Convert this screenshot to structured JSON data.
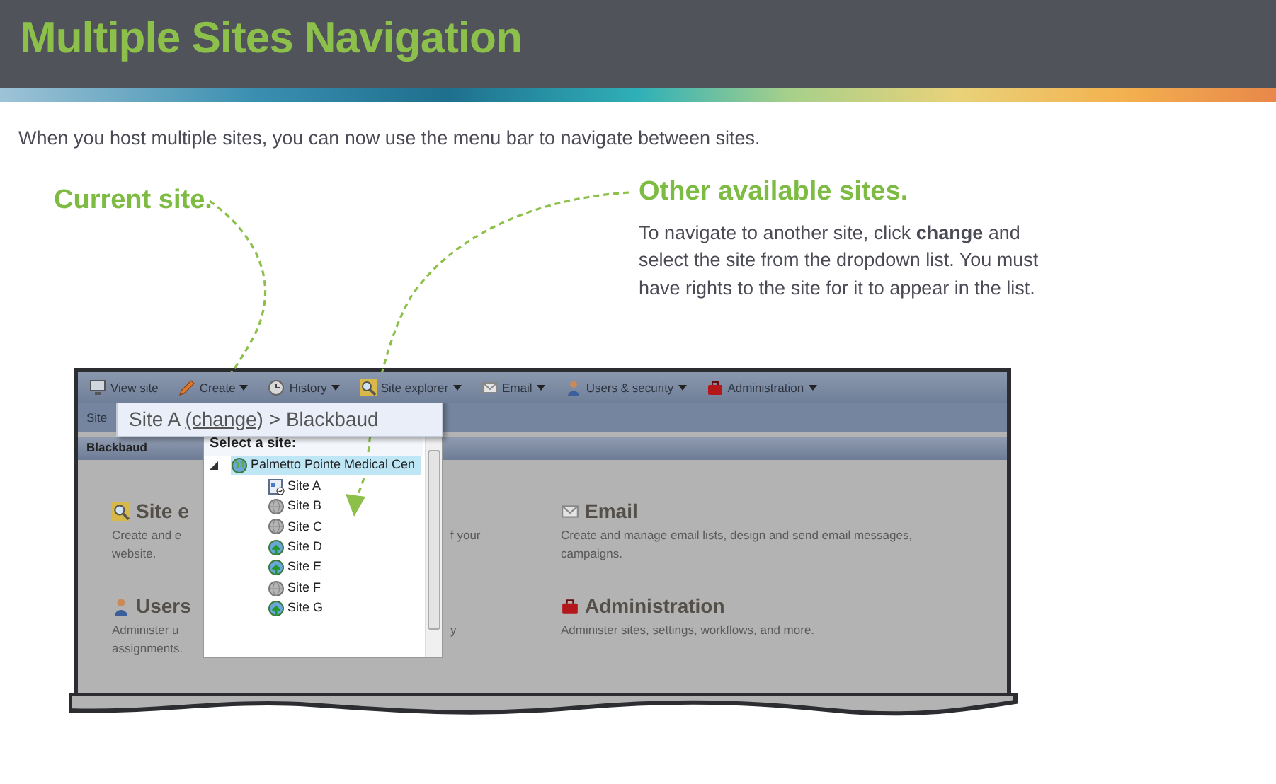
{
  "header": {
    "title": "Multiple Sites Navigation"
  },
  "intro": "When you host multiple sites, you can now use the menu bar to navigate between sites.",
  "callouts": [
    {
      "kind": "current",
      "title": "Current site."
    },
    {
      "kind": "other",
      "title": "Other available sites.",
      "text": "To navigate to another site, click **change** and select the site from the dropdown list. You must have rights to the site for it to appear in the list."
    }
  ],
  "screenshot": {
    "menu": [
      {
        "label": "View site",
        "kind": "monitor",
        "dropdown": false
      },
      {
        "label": "Create",
        "kind": "pencil",
        "dropdown": true
      },
      {
        "label": "History",
        "kind": "clock",
        "dropdown": true
      },
      {
        "label": "Site explorer",
        "kind": "magnifier",
        "dropdown": true
      },
      {
        "label": "Email",
        "kind": "envelope",
        "dropdown": true
      },
      {
        "label": "Users & security",
        "kind": "person",
        "dropdown": true
      },
      {
        "label": "Administration",
        "kind": "toolbox",
        "dropdown": true
      }
    ],
    "second_row_label": "Site",
    "breadcrumb": {
      "current": "Site A",
      "link": "(change)",
      "separator": ">",
      "root": "Blackbaud"
    },
    "page_header": "Blackbaud",
    "site_picker": {
      "title": "Select a site:",
      "root": {
        "label": "Palmetto Pointe Medical Cen",
        "selected": true,
        "expanded": true,
        "children": [
          {
            "label": "Site A",
            "kind": "current",
            "selected": false
          },
          {
            "label": "Site B",
            "kind": "inactive",
            "selected": false
          },
          {
            "label": "Site C",
            "kind": "inactive",
            "selected": false
          },
          {
            "label": "Site D",
            "kind": "active",
            "selected": false
          },
          {
            "label": "Site E",
            "kind": "active",
            "selected": false
          },
          {
            "label": "Site F",
            "kind": "inactive",
            "selected": false
          },
          {
            "label": "Site G",
            "kind": "active",
            "selected": false
          }
        ]
      }
    },
    "cards": [
      {
        "kind": "magnifier",
        "title": "Site e",
        "lines": [
          {
            "left": "Create and e",
            "right": "f your"
          },
          {
            "left": "website."
          }
        ]
      },
      {
        "kind": "envelope",
        "title": "Email",
        "lines": [
          {
            "left": "Create and manage email lists, design and send email messages,"
          },
          {
            "left": "campaigns."
          }
        ]
      },
      {
        "kind": "person",
        "title": "Users",
        "lines": [
          {
            "left": "Administer u",
            "right": "y"
          },
          {
            "left": "assignments."
          }
        ]
      },
      {
        "kind": "toolbox",
        "title": "Administration",
        "lines": [
          {
            "left": "Administer sites, settings, workflows, and more."
          }
        ]
      }
    ]
  }
}
